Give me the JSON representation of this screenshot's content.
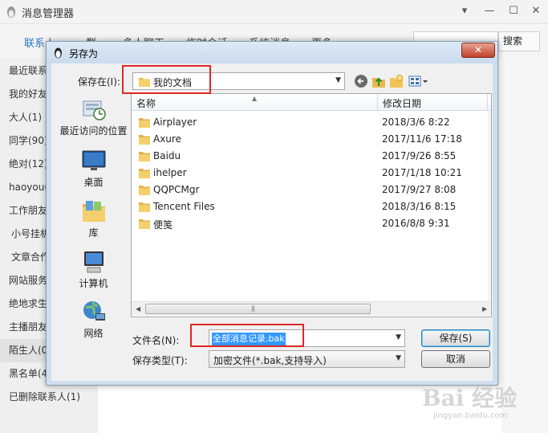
{
  "bg_window": {
    "title": "消息管理器",
    "controls": {
      "min": "▾",
      "restore": "—",
      "max": "☐",
      "close": "✕"
    },
    "tabs": [
      "联系人",
      "群",
      "多人聊天",
      "临时会话",
      "系统消息",
      "更多"
    ],
    "search_button": "搜索",
    "contacts": [
      "最近联系人",
      "我的好友",
      "大人(1)",
      "同学(90)",
      "绝对(12)",
      "haoyou(2",
      "工作朋友",
      "小号挂机",
      "文章合作",
      "网站服务",
      "绝地求生",
      "主播朋友",
      "陌生人(0)",
      "黑名单(4)",
      "已删除联系人(1)"
    ]
  },
  "dialog": {
    "title": "另存为",
    "close_glyph": "✕",
    "save_in_label": "保存在(I):",
    "save_in_value": "我的文档",
    "places": [
      "最近访问的位置",
      "桌面",
      "库",
      "计算机",
      "网络"
    ],
    "columns": {
      "name": "名称",
      "date": "修改日期"
    },
    "files": [
      {
        "name": "Airplayer",
        "date": "2018/3/6 8:22"
      },
      {
        "name": "Axure",
        "date": "2017/11/6 17:18"
      },
      {
        "name": "Baidu",
        "date": "2017/9/26 8:55"
      },
      {
        "name": "ihelper",
        "date": "2017/1/18 10:21"
      },
      {
        "name": "QQPCMgr",
        "date": "2017/9/27 8:08"
      },
      {
        "name": "Tencent Files",
        "date": "2018/3/16 8:15"
      },
      {
        "name": "便笺",
        "date": "2016/8/8 9:31"
      }
    ],
    "filename_label": "文件名(N):",
    "filename_value": "全部消息记录.bak",
    "filetype_label": "保存类型(T):",
    "filetype_value": "加密文件(*.bak,支持导入)",
    "save_button": "保存(S)",
    "cancel_button": "取消"
  },
  "watermark": {
    "brand": "Bai 经验",
    "url": "jingyan.baidu.com"
  },
  "colors": {
    "highlight": "#e02626",
    "selection": "#3399ff",
    "active_tab": "#2c77c8"
  }
}
